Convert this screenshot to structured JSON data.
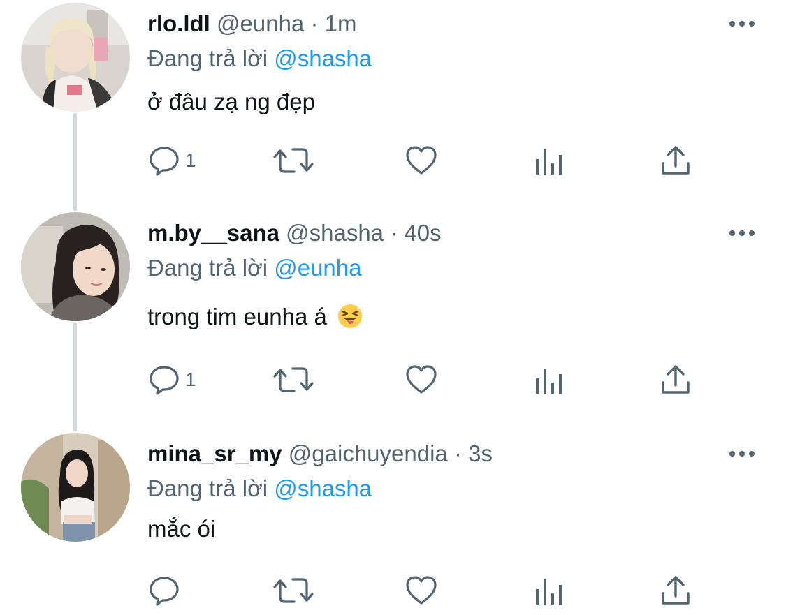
{
  "tweets": [
    {
      "name": "rlo.ldl",
      "handle": "@eunha",
      "sep": "·",
      "time": "1m",
      "reply_prefix": "Đang trả lời",
      "reply_to": "@shasha",
      "text": "ở đâu zạ ng đẹp",
      "reply_count": "1",
      "avatar_icon": "profile-photo"
    },
    {
      "name": "m.by__sana",
      "handle": "@shasha",
      "sep": "·",
      "time": "40s",
      "reply_prefix": "Đang trả lời",
      "reply_to": "@eunha",
      "text": "trong tim eunha á",
      "emoji": "squinting-face-with-tongue",
      "reply_count": "1",
      "avatar_icon": "profile-photo"
    },
    {
      "name": "mina_sr_my",
      "handle": "@gaichuyendia",
      "sep": "·",
      "time": "3s",
      "reply_prefix": "Đang trả lời",
      "reply_to": "@shasha",
      "text": "mắc ói",
      "reply_count": "",
      "avatar_icon": "profile-photo"
    }
  ],
  "icons": {
    "more": "more-horizontal-icon",
    "reply": "reply-bubble-icon",
    "retweet": "retweet-icon",
    "like": "heart-icon",
    "views": "views-bar-chart-icon",
    "share": "share-upload-icon"
  },
  "colors": {
    "text": "#0f1419",
    "secondary": "#536471",
    "accent": "#1d9bf0",
    "thread_line": "#cfd9de"
  }
}
